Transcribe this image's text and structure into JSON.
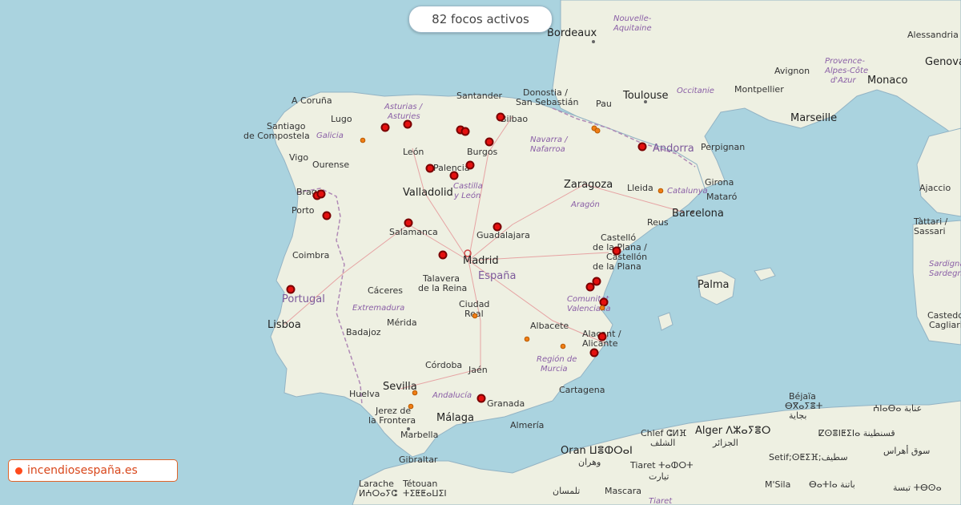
{
  "counter": {
    "text": "82 focos activos"
  },
  "brand": {
    "text": "incendiosespaña.es"
  },
  "colors": {
    "fire": "#e4100f",
    "fire_border": "#7a0000",
    "minor_fire": "#ef7d16",
    "land": "#f2efe9",
    "sea": "#aad3df",
    "brand": "#e0642a"
  },
  "places": {
    "bordeaux": "Bordeaux",
    "nouvelle": "Nouvelle-",
    "aquitaine": "Aquitaine",
    "toulouse": "Toulouse",
    "occitanie": "Occitanie",
    "montpellier": "Montpellier",
    "marseille": "Marseille",
    "avignon": "Avignon",
    "provence1": "Provence-",
    "provence2": "Alpes-Côte",
    "provence3": "d'Azur",
    "monaco": "Monaco",
    "genova": "Genova",
    "alessandria": "Alessandria",
    "perpignan": "Perpignan",
    "andorra": "Andorra",
    "pau": "Pau",
    "donostia": "Donostia /",
    "sansebastian": "San Sebastián",
    "santander": "Santander",
    "bilbao": "Bilbao",
    "acoruna": "A Coruña",
    "santiago1": "Santiago",
    "santiago2": "de Compostela",
    "lugo": "Lugo",
    "galicia": "Galicia",
    "asturias1": "Asturias /",
    "asturias2": "Asturies",
    "leon": "León",
    "burgos": "Burgos",
    "navarra1": "Navarra /",
    "navarra2": "Nafarroa",
    "vigo": "Vigo",
    "ourense": "Ourense",
    "braga": "Braga",
    "palencia": "Palencia",
    "valladolid": "Valladolid",
    "castilla1": "Castilla",
    "castilla2": "y León",
    "zaragoza": "Zaragoza",
    "lleida": "Lleida",
    "catalunya": "Catalunya",
    "girona": "Girona",
    "mataro": "Mataró",
    "barcelona": "Barcelona",
    "aragon": "Aragón",
    "reus": "Reus",
    "porto": "Porto",
    "salamanca": "Salamanca",
    "guadalajara": "Guadalajara",
    "madrid": "Madrid",
    "espana": "España",
    "castello1": "Castelló",
    "castello2": "de la Plana /",
    "castello3": "Castellón",
    "castello4": "de la Plana",
    "coimbra": "Coimbra",
    "talavera1": "Talavera",
    "talavera2": "de la Reina",
    "caceres": "Cáceres",
    "portugal": "Portugal",
    "extremadura": "Extremadura",
    "ciudadreal1": "Ciudad",
    "ciudadreal2": "Real",
    "comunitat1": "Comunitat",
    "comunitat2": "Valenciana",
    "lisboa": "Lisboa",
    "badajoz": "Badajoz",
    "merida": "Mérida",
    "albacete": "Albacete",
    "alacant1": "Alacant /",
    "alacant2": "Alicante",
    "palma": "Palma",
    "region1": "Región de",
    "region2": "Murcia",
    "cordoba": "Córdoba",
    "jaen": "Jaén",
    "huelva": "Huelva",
    "sevilla": "Sevilla",
    "andalucia": "Andalucía",
    "jerez1": "Jerez de",
    "jerez2": "la Frontera",
    "granada": "Granada",
    "malaga": "Málaga",
    "almeria": "Almería",
    "cartagena": "Cartagena",
    "marbella": "Marbella",
    "gibraltar": "Gibraltar",
    "ajaccio": "Ajaccio",
    "tattari1": "Tàttari /",
    "tattari2": "Sassari",
    "sardigna1": "Sardigna /",
    "sardigna2": "Sardegna",
    "casteddu1": "Casteddu /",
    "casteddu2": "Cagliari",
    "bejaia1": "Béjaïa",
    "bejaia2": "ⴱⴳⴰⵢⴻⵜ",
    "bejaia3": "بجاية",
    "annaba": "ⵄⵏⴰⴱⴰ عنابة",
    "chlef1": "Chlef ⵛⵍⴼ",
    "chlef2": "الشلف",
    "alger1": "Alger ⴷⵣⴰⵢⴻⵔ",
    "alger2": "الجزائر",
    "constantine": "ⵇⵙⴻⵏⵟⵉⵏⴰ قسنطينة",
    "oran1": "Oran ⵡⴻⵀⵔⴰⵏ",
    "oran2": "وهران",
    "tiaret1": "Tiaret ⵜⴰⵀⵔⵜ",
    "tiaret2": "تيارت",
    "setif": "Setif;ⵙⵟⵉⴼ;سطيف",
    "larache1": "Larache",
    "larache2": "ⵍⵄⵔⴰⵢⵛ",
    "tetouan1": "Tétouan",
    "tetouan2": "ⵜⵉⵟⵟⴰⵡⵉⵏ",
    "tlemcen": "تلمسان",
    "mascara": "Mascara",
    "tiaretregion": "Tiaret",
    "batna": "ⴱⴰⵜⵏⴰ باتنة",
    "msila": "M'Sila",
    "tebessa": "تبسة ⵜⴱⵙⴰ",
    "soukahras": "سوق أهراس"
  }
}
